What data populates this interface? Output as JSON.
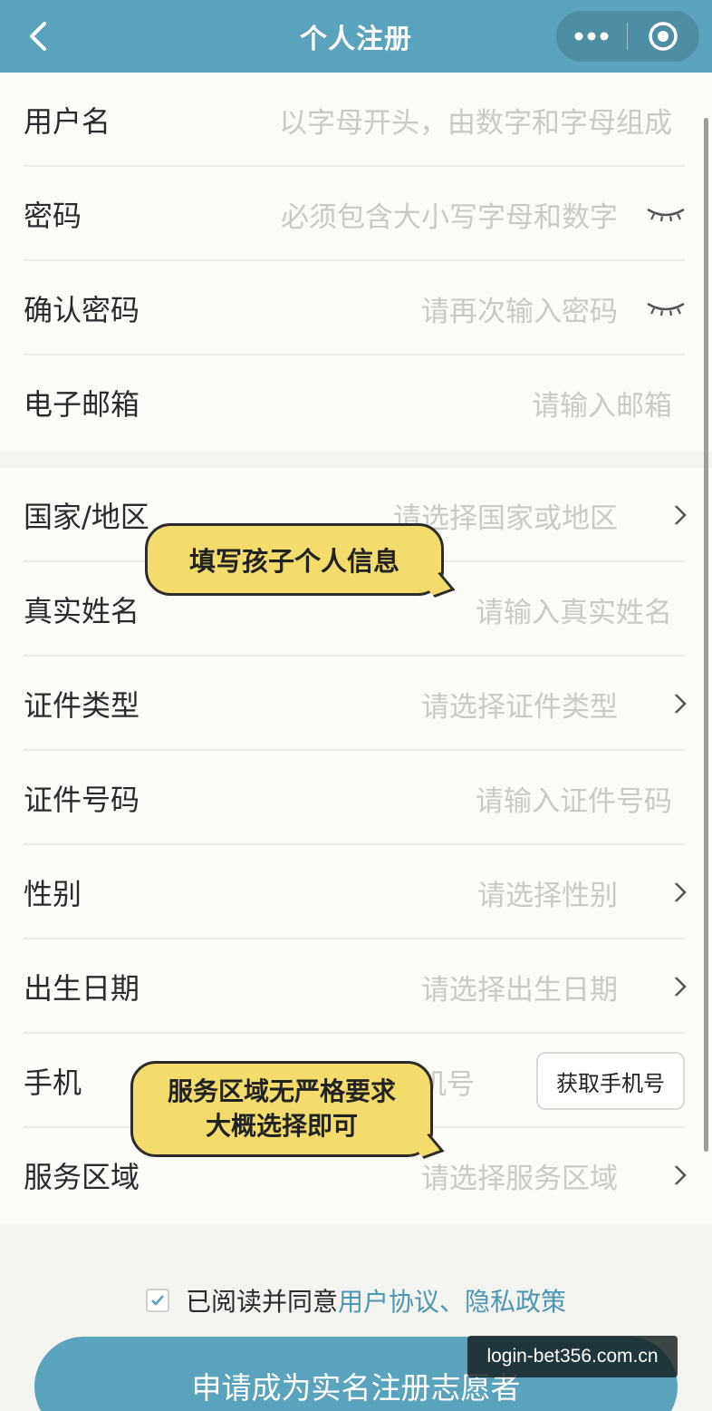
{
  "header": {
    "title": "个人注册",
    "back_icon": "chevron-left-icon",
    "more_icon": "more-dots-icon",
    "close_icon": "target-close-icon",
    "background_color": "#5aa3bd"
  },
  "account_section": {
    "fields": [
      {
        "label": "用户名",
        "placeholder": "以字母开头，由数字和字母组成"
      },
      {
        "label": "密码",
        "placeholder": "必须包含大小写字母和数字",
        "icon": "eye-closed-icon"
      },
      {
        "label": "确认密码",
        "placeholder": "请再次输入密码",
        "icon": "eye-closed-icon"
      },
      {
        "label": "电子邮箱",
        "placeholder": "请输入邮箱"
      }
    ]
  },
  "info_section": {
    "fields": [
      {
        "label": "国家/地区",
        "placeholder": "请选择国家或地区",
        "icon": "chevron-right-icon"
      },
      {
        "label": "真实姓名",
        "placeholder": "请输入真实姓名"
      },
      {
        "label": "证件类型",
        "placeholder": "请选择证件类型",
        "icon": "chevron-right-icon"
      },
      {
        "label": "证件号码",
        "placeholder": "请输入证件号码"
      },
      {
        "label": "性别",
        "placeholder": "请选择性别",
        "icon": "chevron-right-icon"
      },
      {
        "label": "出生日期",
        "placeholder": "请选择出生日期",
        "icon": "chevron-right-icon"
      },
      {
        "label": "手机",
        "placeholder": "机号",
        "button": "获取手机号"
      },
      {
        "label": "服务区域",
        "placeholder": "请选择服务区域",
        "icon": "chevron-right-icon"
      }
    ]
  },
  "annotations": {
    "bubble1": "填写孩子个人信息",
    "bubble2_line1": "服务区域无严格要求",
    "bubble2_line2": "大概选择即可"
  },
  "agreement": {
    "checked": true,
    "text": "已阅读并同意",
    "links": "用户协议、隐私政策",
    "link_color": "#4c96b3"
  },
  "submit": {
    "label": "申请成为实名注册志愿者"
  },
  "watermark": "login-bet356.com.cn"
}
